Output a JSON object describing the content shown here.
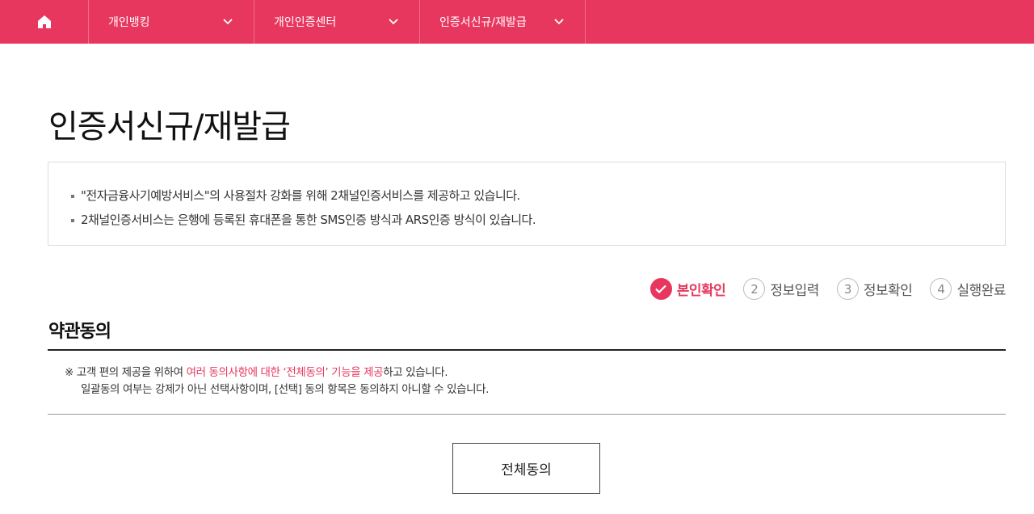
{
  "gnb": {
    "menus": [
      {
        "label": "개인뱅킹"
      },
      {
        "label": "개인인증센터"
      },
      {
        "label": "인증서신규/재발급"
      }
    ]
  },
  "page": {
    "title": "인증서신규/재발급"
  },
  "notice": {
    "line1": "\"전자금융사기예방서비스\"의 사용절차 강화를 위해 2채널인증서비스를 제공하고 있습니다.",
    "line2": "2채널인증서비스는 은행에 등록된 휴대폰을 통한 SMS인증 방식과 ARS인증 방식이 있습니다."
  },
  "steps": [
    {
      "num": "",
      "label": "본인확인",
      "active": true
    },
    {
      "num": "2",
      "label": "정보입력",
      "active": false
    },
    {
      "num": "3",
      "label": "정보확인",
      "active": false
    },
    {
      "num": "4",
      "label": "실행완료",
      "active": false
    }
  ],
  "terms": {
    "title": "약관동의",
    "note_prefix": "※ 고객 편의 제공을 위하여 ",
    "note_highlight": "여러 동의사항에 대한 ‘전체동의’ 기능을 제공",
    "note_suffix": "하고 있습니다.",
    "note_line2": "일괄동의 여부는 강제가 아닌 선택사항이며, [선택] 동의 항목은 동의하지 아니할 수 있습니다.",
    "agree_all_label": "전체동의"
  },
  "colors": {
    "brand": "#e8375f"
  }
}
